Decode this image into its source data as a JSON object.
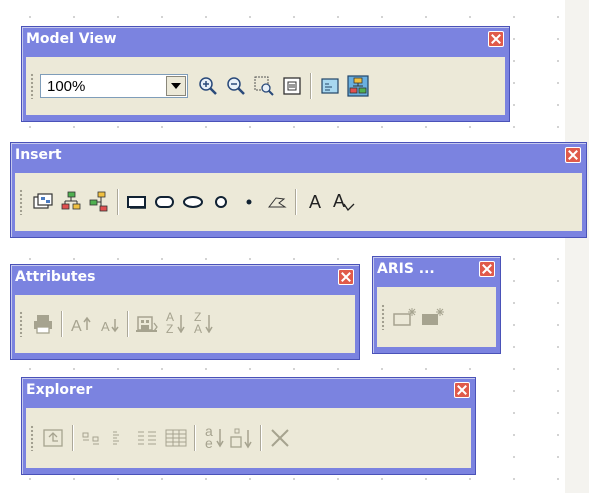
{
  "toolbars": {
    "model_view": {
      "title": "Model View",
      "zoom_value": "100%",
      "buttons": [
        "zoom-in",
        "zoom-out",
        "zoom-area",
        "fit-window",
        "overview",
        "properties"
      ]
    },
    "insert": {
      "title": "Insert",
      "text_a": "A",
      "text_a_formatted": "A"
    },
    "attributes": {
      "title": "Attributes",
      "az_top": "A",
      "az_bottom": "Z",
      "za_top": "Z",
      "za_bottom": "A"
    },
    "aris": {
      "title": "ARIS ..."
    },
    "explorer": {
      "title": "Explorer",
      "sort_top": "a",
      "sort_bottom": "e"
    }
  },
  "colors": {
    "title_bar": "#7b83e0",
    "toolbar_body": "#ece9d8",
    "close_button": "#e05a4a",
    "disabled_icon": "#a6a38f"
  }
}
